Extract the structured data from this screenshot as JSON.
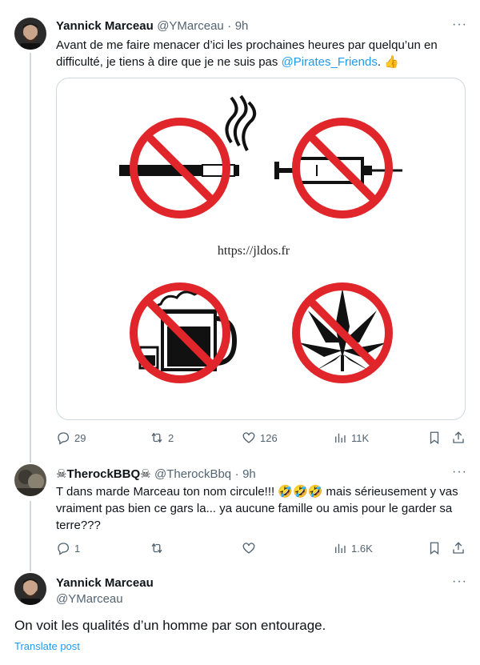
{
  "tweets": [
    {
      "author": "Yannick Marceau",
      "handle": "@YMarceau",
      "sep": "·",
      "time": "9h",
      "text_line1": "Avant de me faire menacer d’ici les prochaines heures par quelqu’un en",
      "text_line2_start": "difficulté, je tiens  à dire que je ne suis pas ",
      "mention": "@Pirates_Friends",
      "text_line2_end": ". ",
      "emoji": "👍",
      "image": {
        "url_text": "https://jldos.fr",
        "icons": [
          "no-smoking-icon",
          "no-drugs-syringe-icon",
          "no-alcohol-icon",
          "no-cannabis-icon"
        ]
      },
      "stats": {
        "replies": "29",
        "reposts": "2",
        "likes": "126",
        "views": "11K"
      }
    },
    {
      "author_prefix_emoji": "☠",
      "author": "TherockBBQ",
      "author_suffix_emoji": "☠",
      "handle": "@TherockBbq",
      "sep": "·",
      "time": "9h",
      "text_line1": "T dans marde Marceau ton nom circule!!! 🤣🤣🤣 mais sérieusement y vas",
      "text_line2": "vraiment pas bien ce gars la... ya aucune famille ou amis pour le garder sa",
      "text_line3": "terre???",
      "stats": {
        "replies": "1",
        "reposts": "",
        "likes": "",
        "views": "1.6K"
      }
    },
    {
      "author": "Yannick Marceau",
      "handle": "@YMarceau",
      "text": "On voit les qualités d’un homme par son entourage.",
      "translate": "Translate post"
    }
  ],
  "more_label": "···",
  "colors": {
    "accent": "#1d9bf0",
    "secondary": "#536471",
    "sign_red": "#e0262a"
  }
}
